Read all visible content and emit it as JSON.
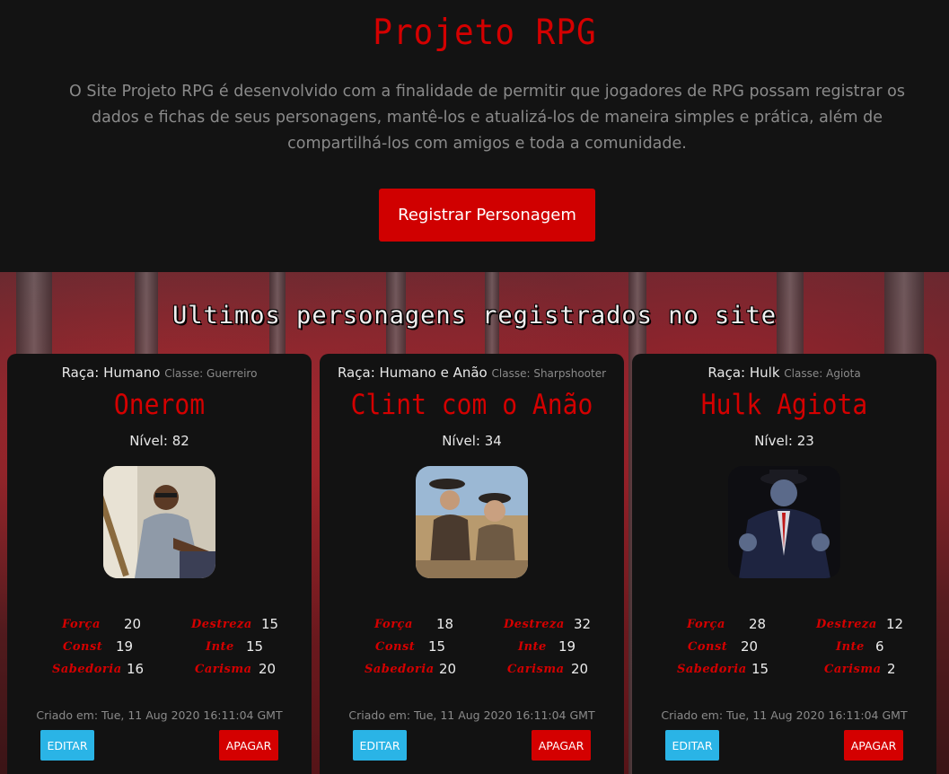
{
  "hero": {
    "title": "Projeto RPG",
    "description": "O Site Projeto RPG é desenvolvido com a finalidade de permitir que jogadores de RPG possam registrar os dados e fichas de seus personagens, mantê-los e atualizá-los de maneira simples e prática, além de compartilhá-los com amigos e toda a comunidade.",
    "cta_label": "Registrar Personagem"
  },
  "section": {
    "title": "Ultimos personagens registrados no site"
  },
  "labels": {
    "race_prefix": "Raça:",
    "class_prefix": "Classe:",
    "level_prefix": "Nível:",
    "created_prefix": "Criado em:",
    "edit": "EDITAR",
    "delete": "APAGAR",
    "forca": "Força",
    "destreza": "Destreza",
    "const": "Const",
    "inte": "Inte",
    "sabedoria": "Sabedoria",
    "carisma": "Carisma"
  },
  "characters": [
    {
      "race": "Humano",
      "class": "Guerreiro",
      "name": "Onerom",
      "level": "82",
      "forca": "20",
      "destreza": "15",
      "const": "19",
      "inte": "15",
      "sabedoria": "16",
      "carisma": "20",
      "created": "Tue, 11 Aug 2020 16:11:04 GMT"
    },
    {
      "race": "Humano e Anão",
      "class": "Sharpshooter",
      "name": "Clint com o Anão",
      "level": "34",
      "forca": "18",
      "destreza": "32",
      "const": "15",
      "inte": "19",
      "sabedoria": "20",
      "carisma": "20",
      "created": "Tue, 11 Aug 2020 16:11:04 GMT"
    },
    {
      "race": "Hulk",
      "class": "Agiota",
      "name": "Hulk Agiota",
      "level": "23",
      "forca": "28",
      "destreza": "12",
      "const": "20",
      "inte": "6",
      "sabedoria": "15",
      "carisma": "2",
      "created": "Tue, 11 Aug 2020 16:11:04 GMT"
    }
  ]
}
